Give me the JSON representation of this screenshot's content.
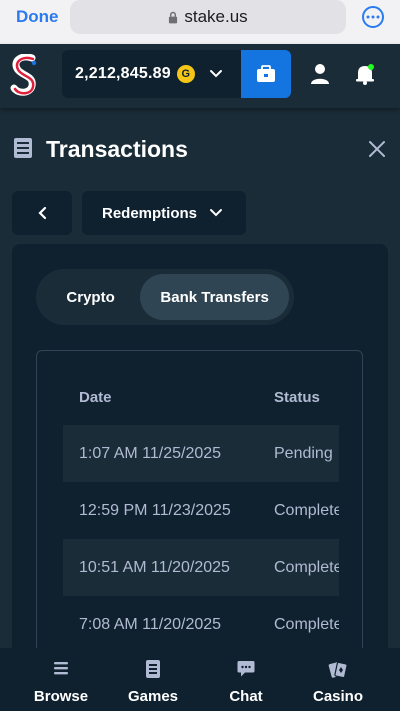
{
  "browser": {
    "done_label": "Done",
    "url": "stake.us"
  },
  "header": {
    "balance": "2,212,845.89",
    "currency_symbol": "G",
    "currency_color": "#f5c518",
    "wallet_color": "#1475e1"
  },
  "page": {
    "title": "Transactions"
  },
  "filter": {
    "type_selected": "Redemptions"
  },
  "tabs": [
    {
      "label": "Crypto",
      "active": false
    },
    {
      "label": "Bank Transfers",
      "active": true
    }
  ],
  "table": {
    "columns": [
      "Date",
      "Status"
    ],
    "rows": [
      {
        "date": "1:07 AM 11/25/2025",
        "status": "Pending"
      },
      {
        "date": "12:59 PM 11/23/2025",
        "status": "Complete"
      },
      {
        "date": "10:51 AM 11/20/2025",
        "status": "Complete"
      },
      {
        "date": "7:08 AM 11/20/2025",
        "status": "Complete"
      }
    ]
  },
  "nav": [
    {
      "label": "Browse",
      "icon": "menu-icon"
    },
    {
      "label": "Games",
      "icon": "games-icon"
    },
    {
      "label": "Chat",
      "icon": "chat-icon"
    },
    {
      "label": "Casino",
      "icon": "casino-icon"
    }
  ]
}
